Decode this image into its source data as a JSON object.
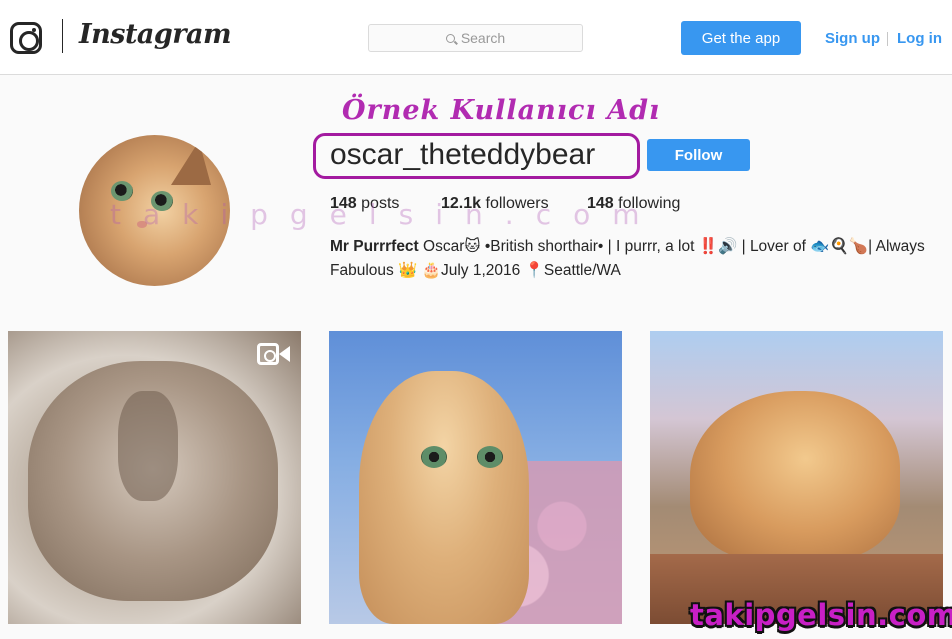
{
  "header": {
    "wordmark": "Instagram",
    "search_placeholder": "Search",
    "get_app_label": "Get the app",
    "signup_label": "Sign up",
    "login_label": "Log in",
    "accent_color": "#3897f0"
  },
  "overlay": {
    "caption": "Örnek Kullanıcı Adı",
    "watermark": "takipgelsin.com",
    "brand_stamp": "takipgelsin.com",
    "highlight_color": "#a31aa0"
  },
  "profile": {
    "username": "oscar_theteddybear",
    "follow_label": "Follow",
    "posts_count": "148",
    "posts_label": "posts",
    "followers_count": "12.1k",
    "followers_label": "followers",
    "following_count": "148",
    "following_label": "following",
    "full_name": "Mr Purrrfect",
    "bio": "Oscar🐱 •British shorthair• | I purrr, a lot ‼️🔊 | Lover of 🐟🍳🍗| Always Fabulous 👑 🎂July 1,2016     📍Seattle/WA"
  },
  "grid": {
    "posts": [
      {
        "type": "video",
        "icon": "video-camera-icon"
      },
      {
        "type": "photo"
      },
      {
        "type": "photo"
      }
    ]
  }
}
